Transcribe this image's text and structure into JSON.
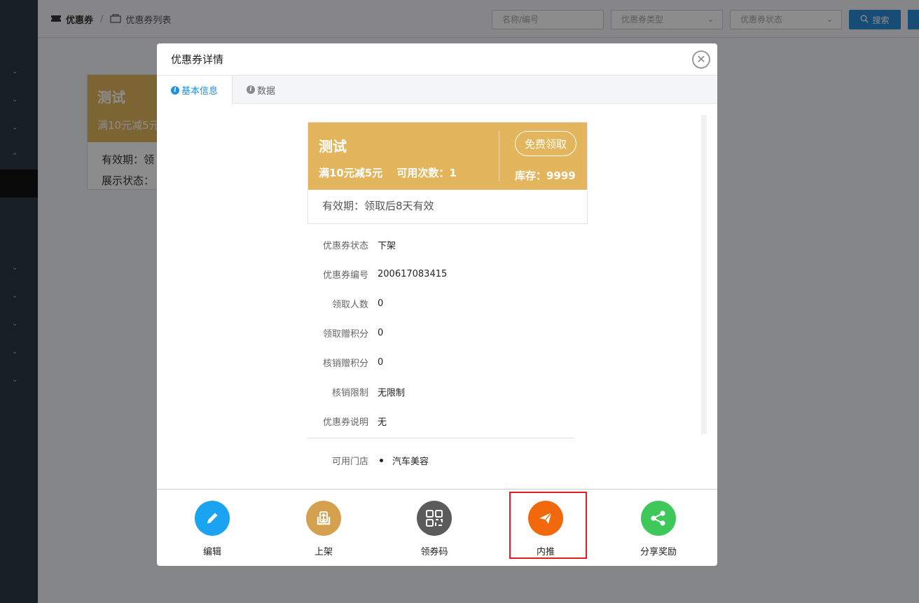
{
  "app": {
    "breadcrumb": {
      "root": "优惠券",
      "separator": "/",
      "current": "优惠券列表"
    },
    "filters": {
      "name_placeholder": "名称/编号",
      "type_placeholder": "优惠券类型",
      "status_placeholder": "优惠券状态",
      "search_label": "搜索"
    },
    "bg_card": {
      "name": "测试",
      "desc": "满10元减5元",
      "validity": "有效期：领",
      "display": "展示状态："
    }
  },
  "modal": {
    "title": "优惠券详情",
    "tabs": [
      {
        "label": "基本信息",
        "active": true
      },
      {
        "label": "数据",
        "active": false
      }
    ],
    "coupon": {
      "name": "测试",
      "condition": "满10元减5元",
      "usage": "可用次数：1",
      "claim_button": "免费领取",
      "stock": "库存：9999",
      "validity": "有效期：领取后8天有效",
      "color": "#e3b65d"
    },
    "details": [
      {
        "key": "优惠券状态",
        "value": "下架"
      },
      {
        "key": "优惠券编号",
        "value": "200617083415"
      },
      {
        "key": "领取人数",
        "value": "0"
      },
      {
        "key": "领取赠积分",
        "value": "0"
      },
      {
        "key": "核销赠积分",
        "value": "0"
      },
      {
        "key": "核销限制",
        "value": "无限制"
      },
      {
        "key": "优惠券说明",
        "value": "无"
      }
    ],
    "stores": {
      "key": "可用门店",
      "items": [
        "汽车美容"
      ]
    },
    "actions": [
      {
        "label": "编辑",
        "icon": "pencil-icon",
        "color": "#1aa3f0"
      },
      {
        "label": "上架",
        "icon": "upload-box-icon",
        "color": "#d4a04e"
      },
      {
        "label": "领券码",
        "icon": "qrcode-icon",
        "color": "#5b5b5b"
      },
      {
        "label": "内推",
        "icon": "paper-plane-icon",
        "color": "#f2690d"
      },
      {
        "label": "分享奖励",
        "icon": "share-icon",
        "color": "#3fc85a"
      }
    ]
  }
}
